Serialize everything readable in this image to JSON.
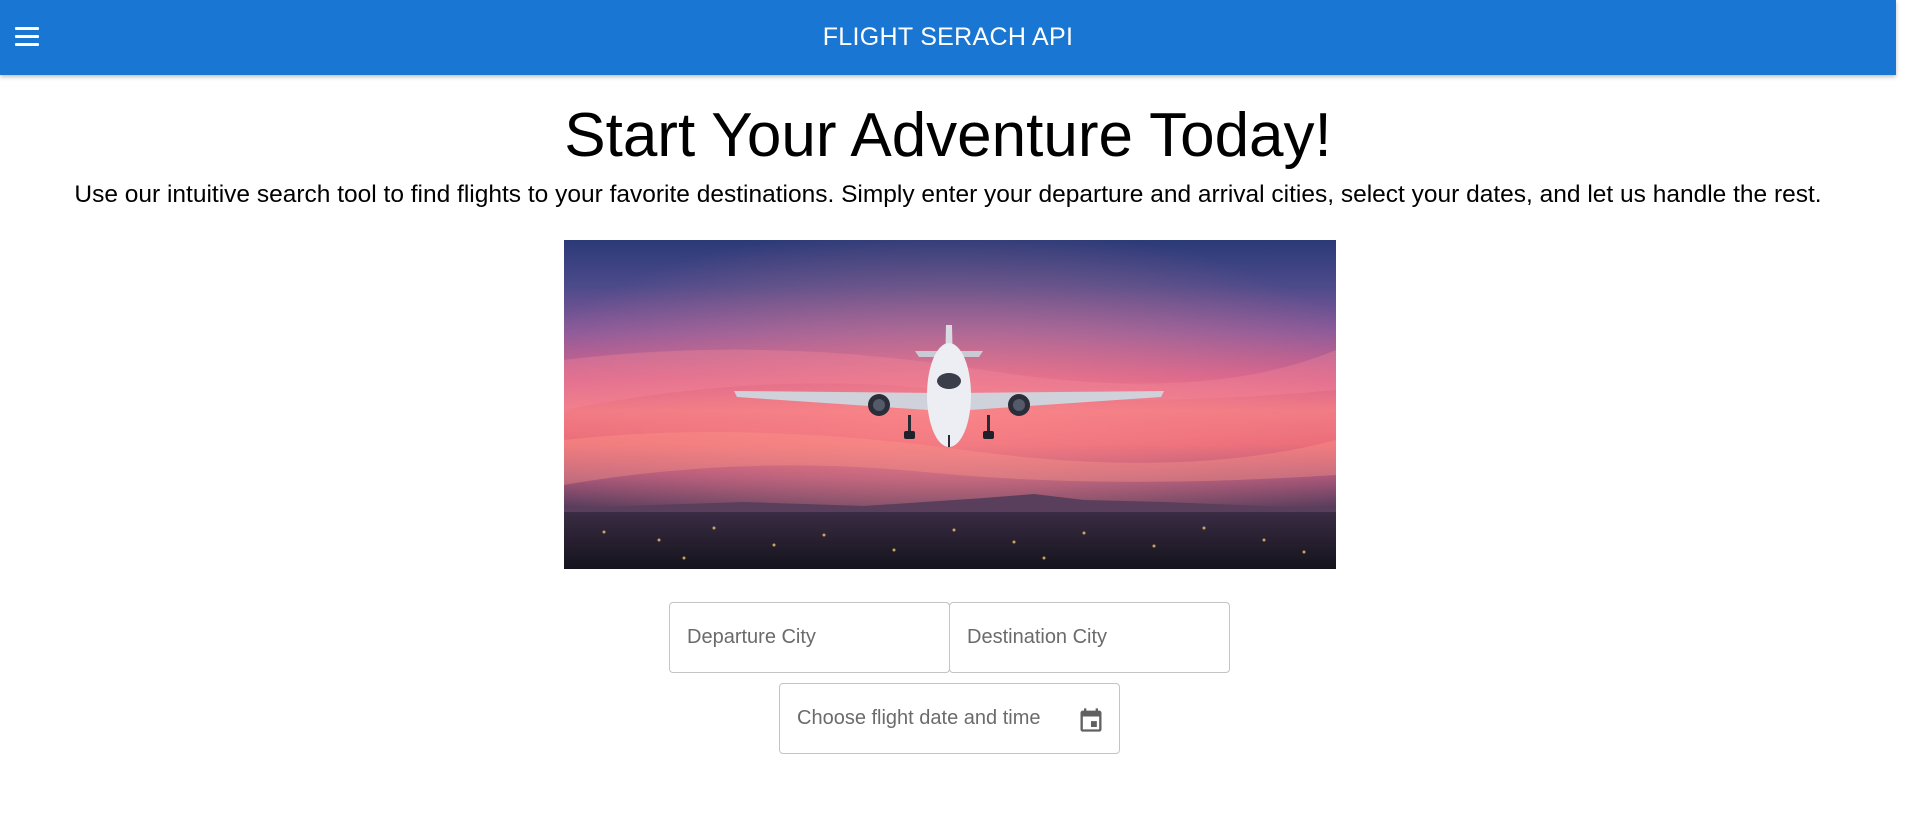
{
  "theme": {
    "accent": "#1976d2"
  },
  "toolbar": {
    "menu_icon": "menu-icon",
    "title": "FLIGHT SERACH API"
  },
  "hero": {
    "title": "Start Your Adventure Today!",
    "subtitle": "Use our intuitive search tool to find flights to your favorite destinations. Simply enter your departure and arrival cities, select your dates, and let us handle the rest.",
    "image": "airplane-sunset-image"
  },
  "search": {
    "departure": {
      "placeholder": "Departure City",
      "value": ""
    },
    "destination": {
      "placeholder": "Destination City",
      "value": ""
    },
    "date": {
      "placeholder": "Choose flight date and time",
      "value": "",
      "icon": "calendar-icon"
    }
  }
}
